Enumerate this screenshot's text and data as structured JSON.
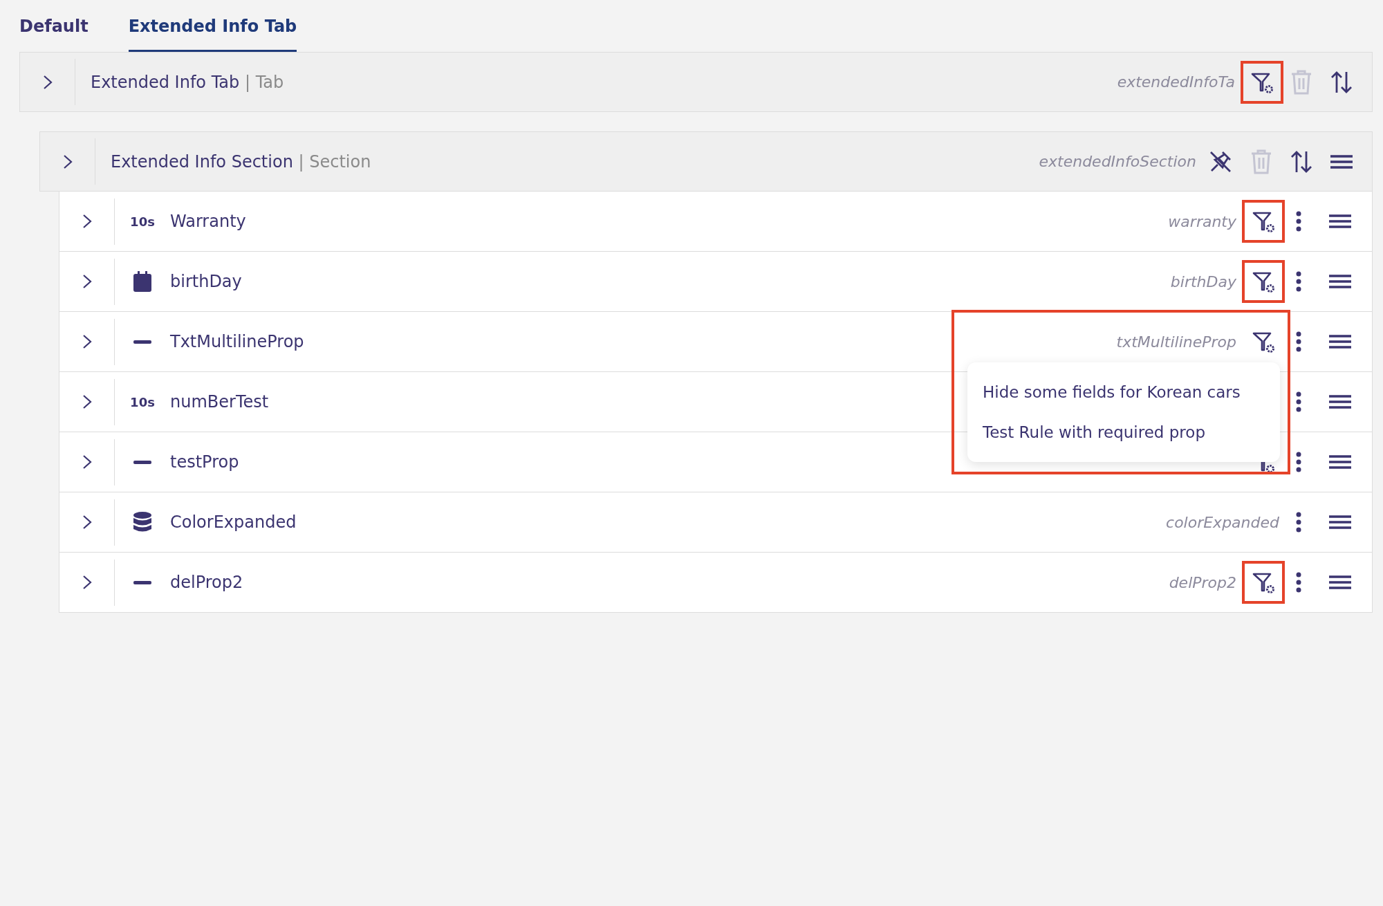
{
  "tabs": [
    {
      "label": "Default",
      "selected": false
    },
    {
      "label": "Extended Info Tab",
      "selected": true
    }
  ],
  "tab_row": {
    "label": "Extended Info Tab",
    "type": "| Tab",
    "api_name": "extendedInfoTa",
    "filter": true,
    "filter_highlighted": true,
    "delete_disabled": true
  },
  "section_row": {
    "label": "Extended Info Section",
    "type": "| Section",
    "api_name": "extendedInfoSection",
    "delete_disabled": true
  },
  "properties": [
    {
      "name": "Warranty",
      "kind": "number",
      "type_label": "10s",
      "api_name": "warranty",
      "filter": true,
      "filter_highlighted": true
    },
    {
      "name": "birthDay",
      "kind": "date",
      "api_name": "birthDay",
      "filter": true,
      "filter_highlighted": true
    },
    {
      "name": "TxtMultilineProp",
      "kind": "text",
      "api_name": "txtMultilineProp",
      "filter": true,
      "filter_highlighted": false,
      "menu": {
        "highlighted": true,
        "items": [
          "Hide some fields for Korean cars",
          "Test Rule with required prop"
        ]
      }
    },
    {
      "name": "numBerTest",
      "kind": "number",
      "type_label": "10s"
    },
    {
      "name": "testProp",
      "kind": "text",
      "filter": true,
      "filter_highlighted": false
    },
    {
      "name": "ColorExpanded",
      "kind": "list",
      "api_name": "colorExpanded",
      "filter": false
    },
    {
      "name": "delProp2",
      "kind": "text",
      "api_name": "delProp2",
      "filter": true,
      "filter_highlighted": true
    }
  ]
}
